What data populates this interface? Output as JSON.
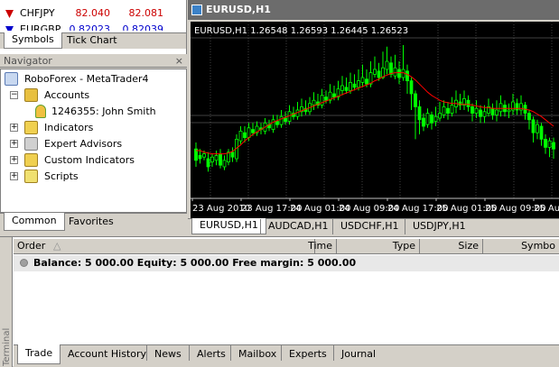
{
  "market_watch": {
    "rows": [
      {
        "symbol": "CHFJPY",
        "bid": "82.040",
        "ask": "82.081"
      },
      {
        "symbol": "EURGBP",
        "bid": "0.82023",
        "ask": "0.82039"
      }
    ],
    "tabs": [
      "Symbols",
      "Tick Chart"
    ]
  },
  "navigator": {
    "title": "Navigator",
    "close": "×",
    "root": "RoboForex - MetaTrader4",
    "accounts": "Accounts",
    "account_item": "1246355: John Smith",
    "indicators": "Indicators",
    "experts": "Expert Advisors",
    "custom_indicators": "Custom Indicators",
    "scripts": "Scripts",
    "tabs": [
      "Common",
      "Favorites"
    ]
  },
  "chart": {
    "window_title": "EURUSD,H1",
    "info": "EURUSD,H1  1.26548 1.26593 1.26445 1.26523",
    "time_labels": [
      "23 Aug 2010",
      "23 Aug 17:00",
      "24 Aug 01:00",
      "24 Aug 09:00",
      "24 Aug 17:00",
      "25 Aug 01:00",
      "25 Aug 09:00",
      "25 Au"
    ],
    "tabs": [
      "EURUSD,H1",
      "AUDCAD,H1",
      "USDCHF,H1",
      "USDJPY,H1"
    ],
    "colors": {
      "bull": "#00ff00",
      "bear": "#00ff00",
      "ma": "#ff0000",
      "grid": "#404040",
      "hline": "#808080"
    }
  },
  "chart_data": {
    "type": "candlestick",
    "symbol": "EURUSD",
    "timeframe": "H1",
    "last_ohlc": {
      "open": 1.26548,
      "high": 1.26593,
      "low": 1.26445,
      "close": 1.26523
    },
    "candles": [
      [
        52,
        38,
        60,
        30
      ],
      [
        44,
        40,
        52,
        34
      ],
      [
        42,
        46,
        50,
        38
      ],
      [
        40,
        30,
        48,
        24
      ],
      [
        36,
        42,
        46,
        30
      ],
      [
        38,
        44,
        50,
        32
      ],
      [
        46,
        32,
        52,
        28
      ],
      [
        30,
        38,
        44,
        26
      ],
      [
        36,
        48,
        52,
        32
      ],
      [
        48,
        42,
        54,
        36
      ],
      [
        40,
        64,
        70,
        36
      ],
      [
        62,
        74,
        80,
        58
      ],
      [
        72,
        66,
        80,
        60
      ],
      [
        66,
        78,
        84,
        62
      ],
      [
        76,
        72,
        84,
        68
      ],
      [
        72,
        80,
        86,
        68
      ],
      [
        78,
        76,
        84,
        70
      ],
      [
        74,
        84,
        90,
        70
      ],
      [
        82,
        78,
        88,
        74
      ],
      [
        76,
        88,
        94,
        72
      ],
      [
        86,
        82,
        94,
        78
      ],
      [
        82,
        92,
        100,
        78
      ],
      [
        90,
        86,
        98,
        82
      ],
      [
        86,
        98,
        106,
        82
      ],
      [
        96,
        92,
        104,
        88
      ],
      [
        92,
        100,
        110,
        88
      ],
      [
        98,
        104,
        114,
        92
      ],
      [
        102,
        98,
        112,
        94
      ],
      [
        98,
        108,
        116,
        94
      ],
      [
        106,
        112,
        122,
        100
      ],
      [
        110,
        106,
        120,
        102
      ],
      [
        106,
        118,
        126,
        102
      ],
      [
        116,
        112,
        124,
        108
      ],
      [
        112,
        122,
        132,
        108
      ],
      [
        120,
        116,
        130,
        112
      ],
      [
        116,
        126,
        136,
        112
      ],
      [
        124,
        130,
        142,
        118
      ],
      [
        128,
        124,
        140,
        120
      ],
      [
        124,
        134,
        146,
        120
      ],
      [
        132,
        128,
        144,
        124
      ],
      [
        128,
        136,
        150,
        124
      ],
      [
        134,
        140,
        156,
        128
      ],
      [
        138,
        132,
        150,
        128
      ],
      [
        132,
        146,
        160,
        128
      ],
      [
        144,
        150,
        166,
        140
      ],
      [
        148,
        140,
        158,
        136
      ],
      [
        140,
        152,
        172,
        138
      ],
      [
        150,
        160,
        178,
        144
      ],
      [
        158,
        144,
        166,
        140
      ],
      [
        142,
        152,
        168,
        138
      ],
      [
        150,
        140,
        160,
        132
      ],
      [
        140,
        150,
        180,
        136
      ],
      [
        148,
        136,
        156,
        120
      ],
      [
        136,
        120,
        140,
        100
      ],
      [
        120,
        104,
        124,
        64
      ],
      [
        104,
        88,
        112,
        70
      ],
      [
        90,
        80,
        96,
        74
      ],
      [
        82,
        96,
        102,
        78
      ],
      [
        94,
        84,
        98,
        76
      ],
      [
        86,
        92,
        104,
        80
      ],
      [
        90,
        96,
        110,
        86
      ],
      [
        94,
        104,
        112,
        90
      ],
      [
        102,
        96,
        110,
        88
      ],
      [
        96,
        106,
        116,
        92
      ],
      [
        104,
        112,
        124,
        96
      ],
      [
        110,
        106,
        120,
        100
      ],
      [
        106,
        114,
        124,
        100
      ],
      [
        112,
        104,
        118,
        98
      ],
      [
        104,
        96,
        108,
        86
      ],
      [
        96,
        102,
        112,
        90
      ],
      [
        100,
        92,
        106,
        84
      ],
      [
        92,
        98,
        106,
        84
      ],
      [
        96,
        104,
        114,
        92
      ],
      [
        102,
        94,
        108,
        88
      ],
      [
        94,
        100,
        112,
        86
      ],
      [
        98,
        108,
        118,
        92
      ],
      [
        106,
        98,
        112,
        92
      ],
      [
        98,
        100,
        108,
        90
      ],
      [
        100,
        110,
        120,
        94
      ],
      [
        108,
        100,
        114,
        94
      ],
      [
        100,
        108,
        118,
        94
      ],
      [
        106,
        96,
        110,
        88
      ],
      [
        96,
        88,
        100,
        76
      ],
      [
        88,
        72,
        92,
        60
      ],
      [
        72,
        82,
        88,
        64
      ],
      [
        80,
        64,
        84,
        56
      ],
      [
        64,
        54,
        70,
        46
      ],
      [
        54,
        62,
        66,
        42
      ],
      [
        60,
        52,
        66,
        40
      ]
    ],
    "ma": [
      50,
      50,
      48,
      47,
      46,
      46,
      46,
      46,
      47,
      49,
      53,
      57,
      62,
      66,
      70,
      73,
      76,
      79,
      82,
      85,
      87,
      89,
      91,
      93,
      95,
      97,
      99,
      101,
      103,
      105,
      107,
      109,
      111,
      113,
      115,
      117,
      119,
      121,
      123,
      125,
      127,
      129,
      131,
      133,
      136,
      138,
      141,
      143,
      145,
      146,
      146,
      146,
      144,
      141,
      137,
      132,
      127,
      122,
      118,
      115,
      112,
      110,
      109,
      108,
      108,
      107,
      107,
      107,
      106,
      105,
      104,
      103,
      103,
      102,
      102,
      102,
      102,
      102,
      102,
      102,
      102,
      101,
      100,
      98,
      95,
      92,
      88,
      84,
      80
    ]
  },
  "terminal": {
    "side_label": "Terminal",
    "columns": [
      "Order",
      "Time",
      "Type",
      "Size",
      "Symbo"
    ],
    "balance_text": "Balance: 5 000.00  Equity: 5 000.00  Free margin: 5 000.00",
    "tabs": [
      "Trade",
      "Account History",
      "News",
      "Alerts",
      "Mailbox",
      "Experts",
      "Journal"
    ]
  }
}
